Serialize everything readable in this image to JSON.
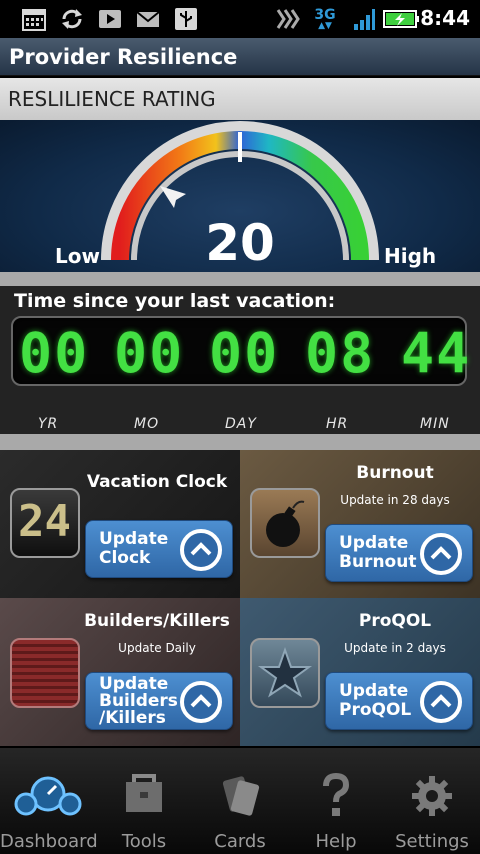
{
  "status_bar": {
    "network": "3G",
    "time": "8:44"
  },
  "title_bar": {
    "title": "Provider Resilience"
  },
  "rating": {
    "header": "RESLILIENCE RATING",
    "value": "20",
    "low_label": "Low",
    "high_label": "High"
  },
  "vacation_timer": {
    "title": "Time since your last vacation:",
    "fields": [
      {
        "digits": "00",
        "unit": "YR"
      },
      {
        "digits": "00",
        "unit": "MO"
      },
      {
        "digits": "00",
        "unit": "DAY"
      },
      {
        "digits": "08",
        "unit": "HR"
      },
      {
        "digits": "44",
        "unit": "MIN"
      }
    ]
  },
  "tiles": {
    "vacation_clock": {
      "title": "Vacation Clock",
      "icon_digits": "24",
      "button_line1": "Update",
      "button_line2": "Clock"
    },
    "burnout": {
      "title": "Burnout",
      "subtitle": "Update in 28 days",
      "button_line1": "Update",
      "button_line2": "Burnout"
    },
    "builders_killers": {
      "title": "Builders/Killers",
      "subtitle": "Update Daily",
      "button_line1": "Update",
      "button_line2": "Builders",
      "button_line3": "/Killers"
    },
    "proqol": {
      "title": "ProQOL",
      "subtitle": "Update in 2 days",
      "button_line1": "Update",
      "button_line2": "ProQOL"
    }
  },
  "nav": {
    "items": [
      {
        "label": "Dashboard",
        "icon": "dashboard-gauge-icon"
      },
      {
        "label": "Tools",
        "icon": "toolbox-icon"
      },
      {
        "label": "Cards",
        "icon": "cards-icon"
      },
      {
        "label": "Help",
        "icon": "question-mark-icon"
      },
      {
        "label": "Settings",
        "icon": "gear-icon"
      }
    ]
  },
  "colors": {
    "lcd_green": "#43e043",
    "button_blue": "#3b78bd",
    "title_bar": "#34465a"
  }
}
